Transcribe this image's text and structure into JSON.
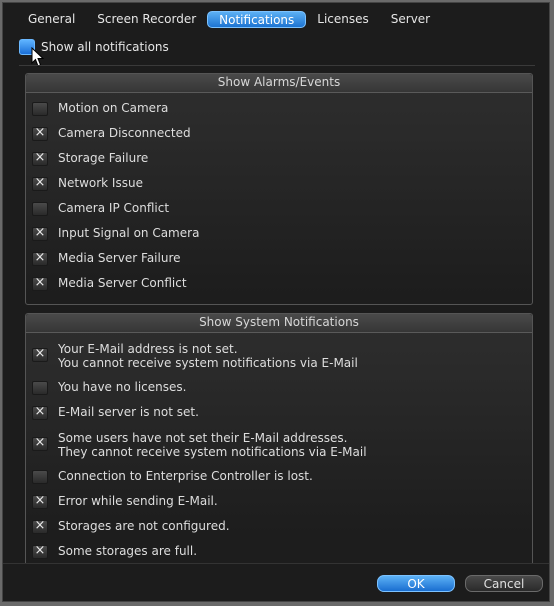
{
  "tabs": [
    {
      "label": "General",
      "active": false
    },
    {
      "label": "Screen Recorder",
      "active": false
    },
    {
      "label": "Notifications",
      "active": true
    },
    {
      "label": "Licenses",
      "active": false
    },
    {
      "label": "Server",
      "active": false
    }
  ],
  "show_all": {
    "label": "Show all notifications",
    "checked": true
  },
  "alarms": {
    "title": "Show Alarms/Events",
    "items": [
      {
        "label": "Motion on Camera",
        "checked": false
      },
      {
        "label": "Camera Disconnected",
        "checked": true
      },
      {
        "label": "Storage Failure",
        "checked": true
      },
      {
        "label": "Network Issue",
        "checked": true
      },
      {
        "label": "Camera IP Conflict",
        "checked": false
      },
      {
        "label": "Input Signal on Camera",
        "checked": true
      },
      {
        "label": "Media Server Failure",
        "checked": true
      },
      {
        "label": "Media Server Conflict",
        "checked": true
      }
    ]
  },
  "system": {
    "title": "Show System Notifications",
    "items": [
      {
        "label": "Your E-Mail address is not set.",
        "label2": "You cannot receive system notifications via E-Mail",
        "checked": true
      },
      {
        "label": "You have no licenses.",
        "label2": "",
        "checked": false
      },
      {
        "label": "E-Mail server is not set.",
        "label2": "",
        "checked": true
      },
      {
        "label": "Some users have not set their E-Mail addresses.",
        "label2": "They cannot receive system notifications via E-Mail",
        "checked": true
      },
      {
        "label": "Connection to Enterprise Controller is lost.",
        "label2": "",
        "checked": false
      },
      {
        "label": "Error while sending E-Mail.",
        "label2": "",
        "checked": true
      },
      {
        "label": "Storages are not configured.",
        "label2": "",
        "checked": true
      },
      {
        "label": "Some storages are full.",
        "label2": "",
        "checked": true
      }
    ]
  },
  "check_glyph": "×",
  "buttons": {
    "ok": "OK",
    "cancel": "Cancel"
  },
  "colors": {
    "accent": "#2a86e4",
    "background": "#1c1c1c"
  }
}
